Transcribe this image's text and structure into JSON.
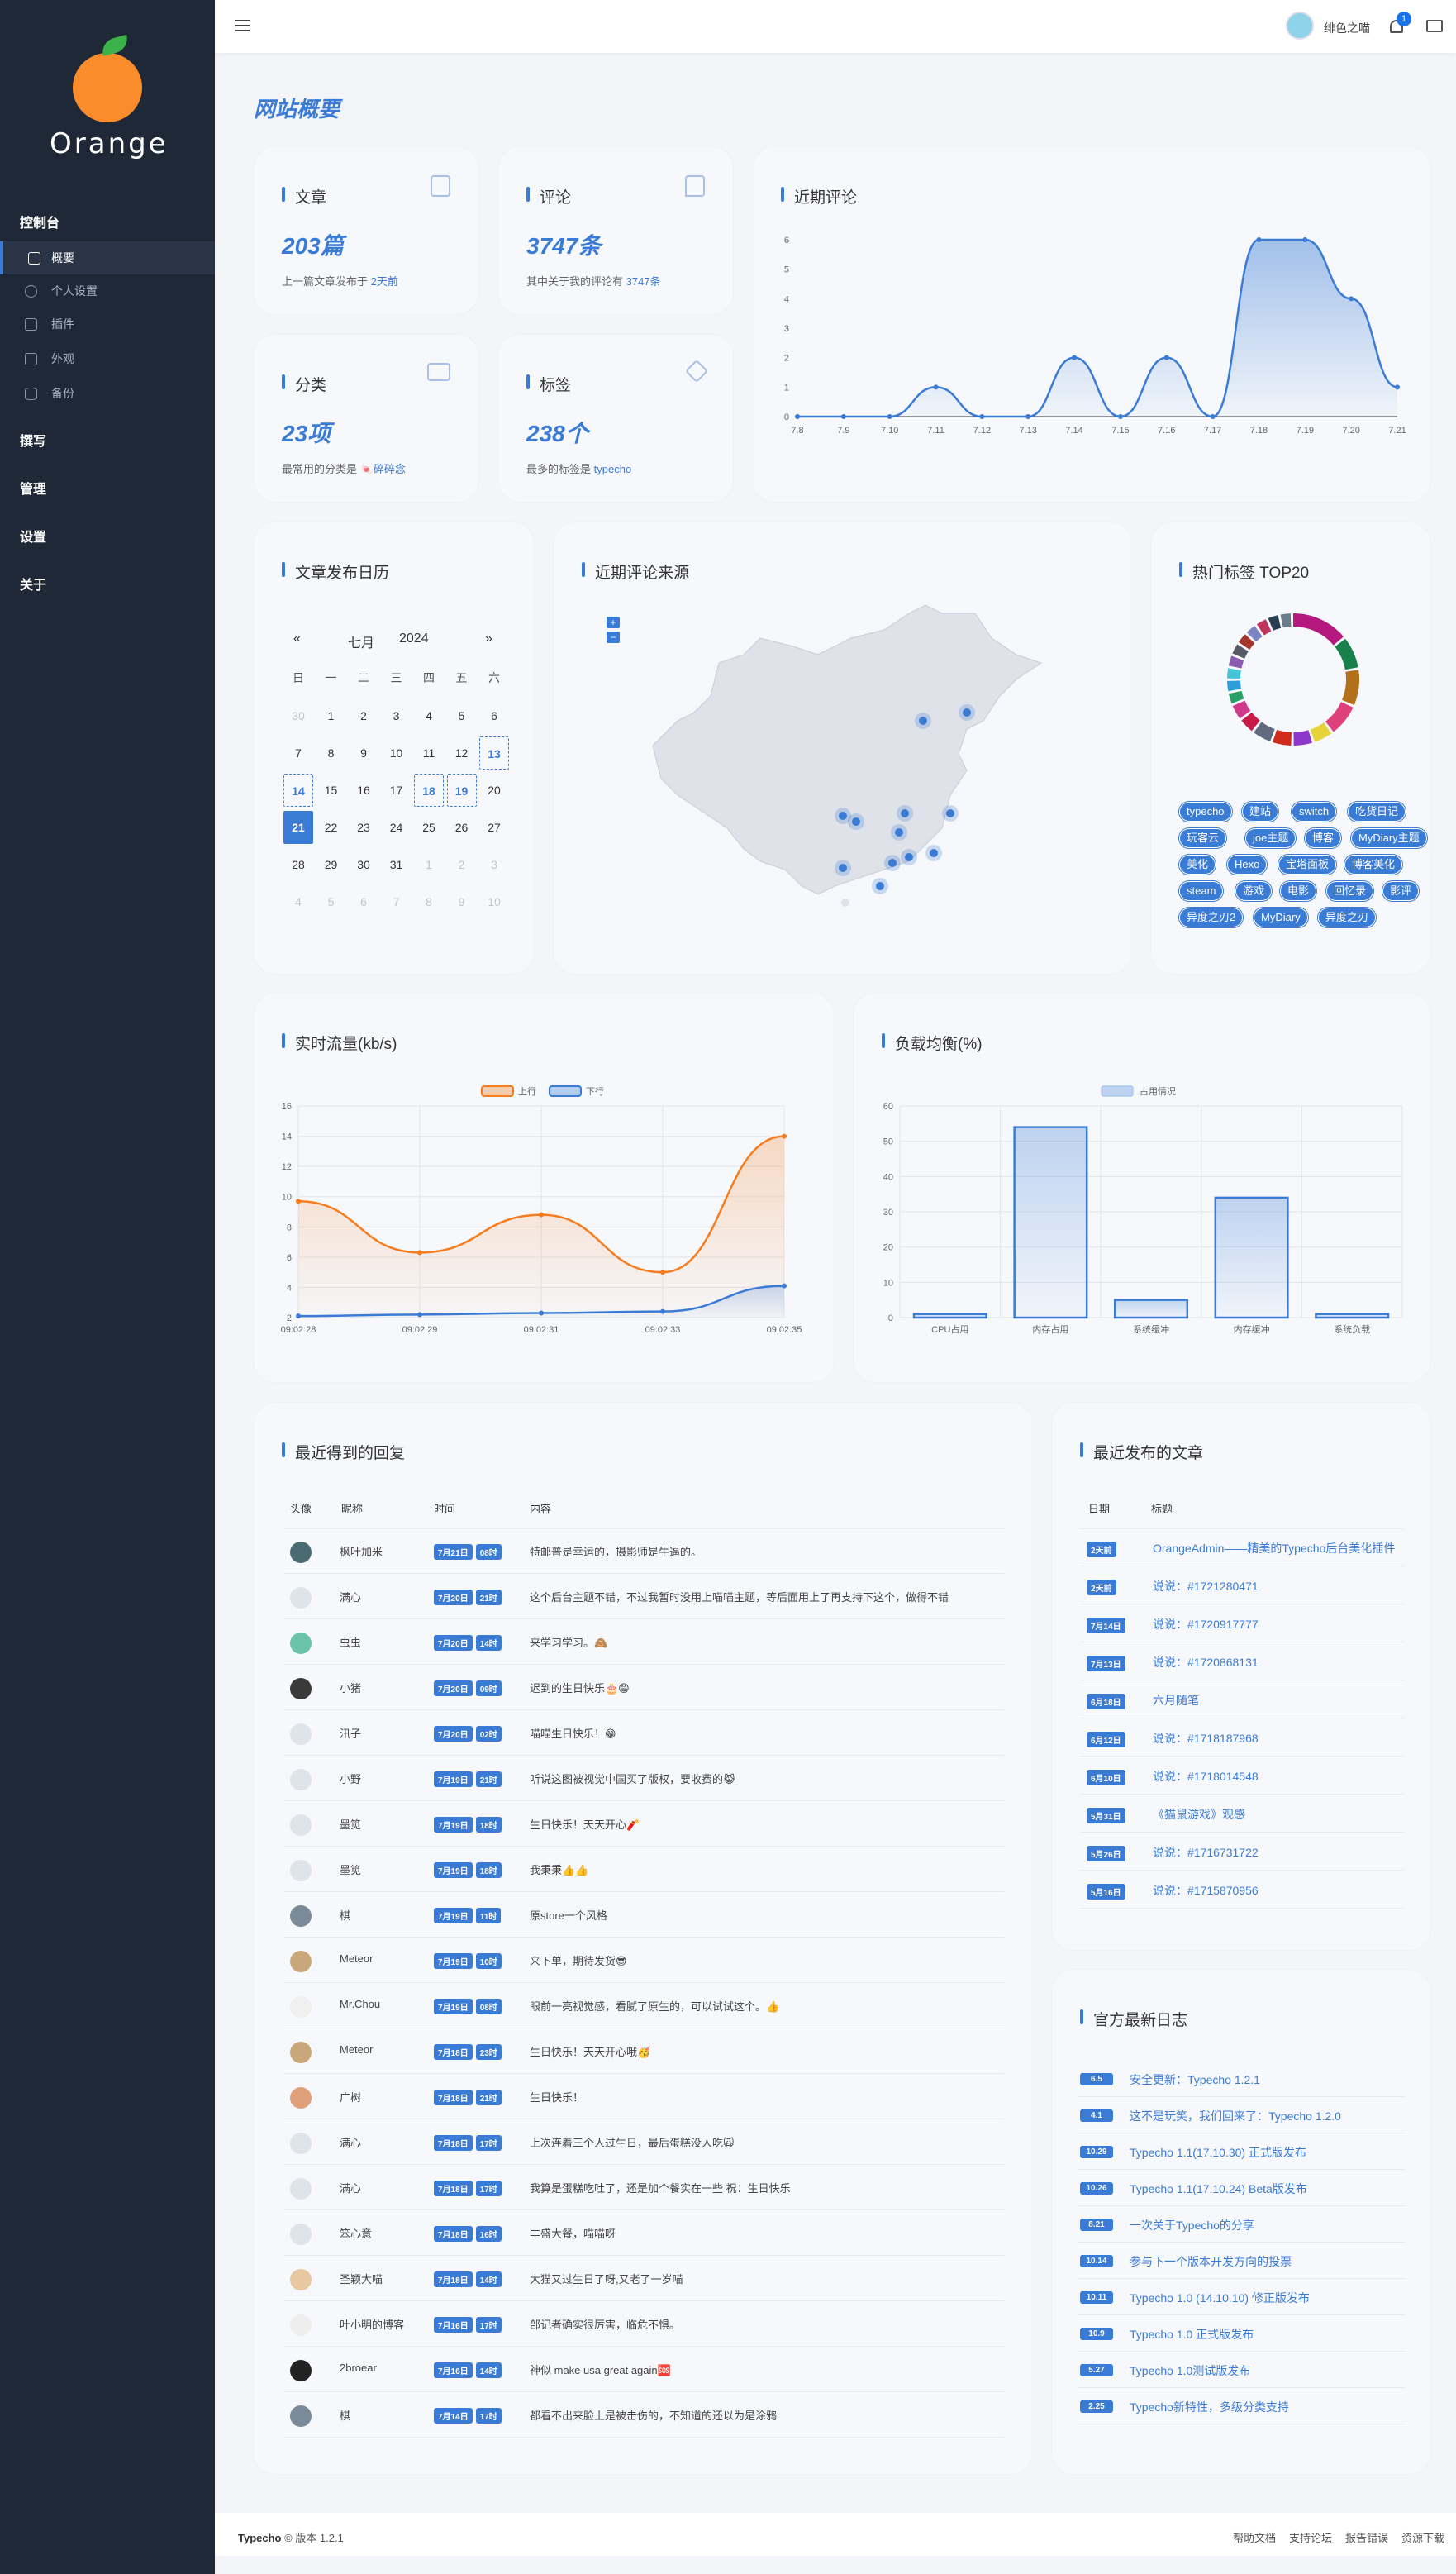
{
  "brand": {
    "logo_text": "Orange"
  },
  "sidebar": {
    "cat_console": "控制台",
    "items": [
      {
        "label": "概要",
        "icon": "layers-icon"
      },
      {
        "label": "个人设置",
        "icon": "user-icon"
      },
      {
        "label": "插件",
        "icon": "box-icon"
      },
      {
        "label": "外观",
        "icon": "layout-icon"
      },
      {
        "label": "备份",
        "icon": "database-icon"
      }
    ],
    "cat_write": "撰写",
    "cat_manage": "管理",
    "cat_settings": "设置",
    "cat_about": "关于"
  },
  "topbar": {
    "username": "绯色之喵",
    "notif_count": "1"
  },
  "page_title": "网站概要",
  "stats": {
    "posts": {
      "title": "文章",
      "value": "203篇",
      "sub": "上一篇文章发布于",
      "sub_link": "2天前"
    },
    "comments": {
      "title": "评论",
      "value": "3747条",
      "sub": "其中关于我的评论有",
      "sub_link": "3747条"
    },
    "categories": {
      "title": "分类",
      "value": "23项",
      "sub": "最常用的分类是",
      "sub_link": "🍬碎碎念"
    },
    "tags": {
      "title": "标签",
      "value": "238个",
      "sub": "最多的标签是",
      "sub_link": "typecho"
    }
  },
  "recent_comments_chart": {
    "title": "近期评论"
  },
  "calendar": {
    "title": "文章发布日历",
    "prev": "«",
    "next": "»",
    "month": "七月",
    "year": "2024",
    "weekdays": [
      "日",
      "一",
      "二",
      "三",
      "四",
      "五",
      "六"
    ],
    "days": [
      [
        "30",
        "1",
        "2",
        "3",
        "4",
        "5",
        "6"
      ],
      [
        "7",
        "8",
        "9",
        "10",
        "11",
        "12",
        "13"
      ],
      [
        "14",
        "15",
        "16",
        "17",
        "18",
        "19",
        "20"
      ],
      [
        "21",
        "22",
        "23",
        "24",
        "25",
        "26",
        "27"
      ],
      [
        "28",
        "29",
        "30",
        "31",
        "1",
        "2",
        "3"
      ],
      [
        "4",
        "5",
        "6",
        "7",
        "8",
        "9",
        "10"
      ]
    ]
  },
  "map": {
    "title": "近期评论来源",
    "zoom_in": "+",
    "zoom_out": "−"
  },
  "hot_tags": {
    "title": "热门标签 TOP20",
    "tags": [
      "typecho",
      "建站",
      "switch",
      "吃货日记",
      "玩客云",
      "joe主题",
      "博客",
      "MyDiary主题",
      "美化",
      "Hexo",
      "宝塔面板",
      "博客美化",
      "steam",
      "游戏",
      "电影",
      "回忆录",
      "影评",
      "异度之刃2",
      "MyDiary",
      "异度之刃"
    ]
  },
  "traffic": {
    "title": "实时流量(kb/s)"
  },
  "load": {
    "title": "负载均衡(%)"
  },
  "chart_data": [
    {
      "type": "line",
      "title": "近期评论",
      "x": [
        "7.8",
        "7.9",
        "7.10",
        "7.11",
        "7.12",
        "7.13",
        "7.14",
        "7.15",
        "7.16",
        "7.17",
        "7.18",
        "7.19",
        "7.20",
        "7.21"
      ],
      "series": [
        {
          "values": [
            0,
            0,
            0,
            1,
            0,
            0,
            2,
            0,
            2,
            0,
            6,
            6,
            4,
            1
          ]
        }
      ],
      "ylim": [
        0,
        6
      ]
    },
    {
      "type": "line",
      "title": "实时流量(kb/s)",
      "x": [
        "09:02:28",
        "09:02:29",
        "09:02:31",
        "09:02:33",
        "09:02:35"
      ],
      "series": [
        {
          "name": "上行",
          "values": [
            9.7,
            6.3,
            8.8,
            5.0,
            14.0
          ],
          "color": "#f57c1f"
        },
        {
          "name": "下行",
          "values": [
            2.1,
            2.2,
            2.3,
            2.4,
            4.1
          ],
          "color": "#3a7bd5"
        }
      ],
      "ylim": [
        2,
        16
      ]
    },
    {
      "type": "bar",
      "title": "负载均衡(%)",
      "categories": [
        "CPU占用",
        "内存占用",
        "系统缓冲",
        "内存缓冲",
        "系统负载"
      ],
      "series": [
        {
          "name": "占用情况",
          "values": [
            1,
            54,
            5,
            34,
            1
          ]
        }
      ],
      "ylim": [
        0,
        60
      ]
    }
  ],
  "replies": {
    "title": "最近得到的回复",
    "headers": [
      "头像",
      "昵称",
      "时间",
      "内容"
    ],
    "rows": [
      {
        "name": "枫叶加米",
        "date": "7月21日",
        "time": "08时",
        "content": "特邮普是幸运的，摄影师是牛逼的。"
      },
      {
        "name": "满心",
        "date": "7月20日",
        "time": "21时",
        "content": "这个后台主题不错，不过我暂时没用上喵喵主题，等后面用上了再支持下这个，做得不错"
      },
      {
        "name": "虫虫",
        "date": "7月20日",
        "time": "14时",
        "content": "来学习学习。🙈"
      },
      {
        "name": "小猪",
        "date": "7月20日",
        "time": "09时",
        "content": "迟到的生日快乐🎂😁"
      },
      {
        "name": "汛子",
        "date": "7月20日",
        "time": "02时",
        "content": "喵喵生日快乐！😁"
      },
      {
        "name": "小野",
        "date": "7月19日",
        "time": "21时",
        "content": "听说这图被视觉中国买了版权，要收费的😹"
      },
      {
        "name": "墨笕",
        "date": "7月19日",
        "time": "18时",
        "content": "生日快乐！天天开心🧨"
      },
      {
        "name": "墨笕",
        "date": "7月19日",
        "time": "18时",
        "content": "我秉秉👍👍"
      },
      {
        "name": "棋",
        "date": "7月19日",
        "time": "11时",
        "content": "原store一个风格"
      },
      {
        "name": "Meteor",
        "date": "7月19日",
        "time": "10时",
        "content": "来下单，期待发货😎"
      },
      {
        "name": "Mr.Chou",
        "date": "7月19日",
        "time": "08时",
        "content": "眼前一亮视觉感，看腻了原生的，可以试试这个。👍"
      },
      {
        "name": "Meteor",
        "date": "7月18日",
        "time": "23时",
        "content": "生日快乐！天天开心哦🥳"
      },
      {
        "name": "广树",
        "date": "7月18日",
        "time": "21时",
        "content": "生日快乐！"
      },
      {
        "name": "满心",
        "date": "7月18日",
        "time": "17时",
        "content": "上次连着三个人过生日，最后蛋糕没人吃🙀"
      },
      {
        "name": "满心",
        "date": "7月18日",
        "time": "17时",
        "content": "我算是蛋糕吃吐了，还是加个餐实在一些 祝：生日快乐"
      },
      {
        "name": "笨心意",
        "date": "7月18日",
        "time": "16时",
        "content": "丰盛大餐，喵喵呀"
      },
      {
        "name": "圣颖大喵",
        "date": "7月18日",
        "time": "14时",
        "content": "大猫又过生日了呀,又老了一岁喵"
      },
      {
        "name": "叶小明的博客",
        "date": "7月16日",
        "time": "17时",
        "content": "部记者确实很厉害，临危不惧。"
      },
      {
        "name": "2broear",
        "date": "7月16日",
        "time": "14时",
        "content": "神似 make usa great again🆘"
      },
      {
        "name": "棋",
        "date": "7月14日",
        "time": "17时",
        "content": "都看不出来脸上是被击伤的，不知道的还以为是涂鸦"
      }
    ]
  },
  "articles": {
    "title": "最近发布的文章",
    "headers": [
      "日期",
      "标题"
    ],
    "rows": [
      {
        "date": "2天前",
        "title": "OrangeAdmin——精美的Typecho后台美化插件"
      },
      {
        "date": "2天前",
        "title": "说说：#1721280471"
      },
      {
        "date": "7月14日",
        "title": "说说：#1720917777"
      },
      {
        "date": "7月13日",
        "title": "说说：#1720868131"
      },
      {
        "date": "6月18日",
        "title": "六月随笔"
      },
      {
        "date": "6月12日",
        "title": "说说：#1718187968"
      },
      {
        "date": "6月10日",
        "title": "说说：#1718014548"
      },
      {
        "date": "5月31日",
        "title": "《猫鼠游戏》观感"
      },
      {
        "date": "5月26日",
        "title": "说说：#1716731722"
      },
      {
        "date": "5月16日",
        "title": "说说：#1715870956"
      }
    ]
  },
  "changelog": {
    "title": "官方最新日志",
    "rows": [
      {
        "date": "6.5",
        "title": "安全更新：Typecho 1.2.1"
      },
      {
        "date": "4.1",
        "title": "这不是玩笑，我们回来了：Typecho 1.2.0"
      },
      {
        "date": "10.29",
        "title": "Typecho 1.1(17.10.30) 正式版发布"
      },
      {
        "date": "10.26",
        "title": "Typecho 1.1(17.10.24) Beta版发布"
      },
      {
        "date": "8.21",
        "title": "一次关于Typecho的分享"
      },
      {
        "date": "10.14",
        "title": "参与下一个版本开发方向的投票"
      },
      {
        "date": "10.11",
        "title": "Typecho 1.0 (14.10.10) 修正版发布"
      },
      {
        "date": "10.9",
        "title": "Typecho 1.0 正式版发布"
      },
      {
        "date": "5.27",
        "title": "Typecho 1.0测试版发布"
      },
      {
        "date": "2.25",
        "title": "Typecho新特性，多级分类支持"
      }
    ]
  },
  "footer": {
    "brand": "Typecho",
    "version": "© 版本 1.2.1",
    "links": [
      "帮助文档",
      "支持论坛",
      "报告错误",
      "资源下载"
    ]
  }
}
